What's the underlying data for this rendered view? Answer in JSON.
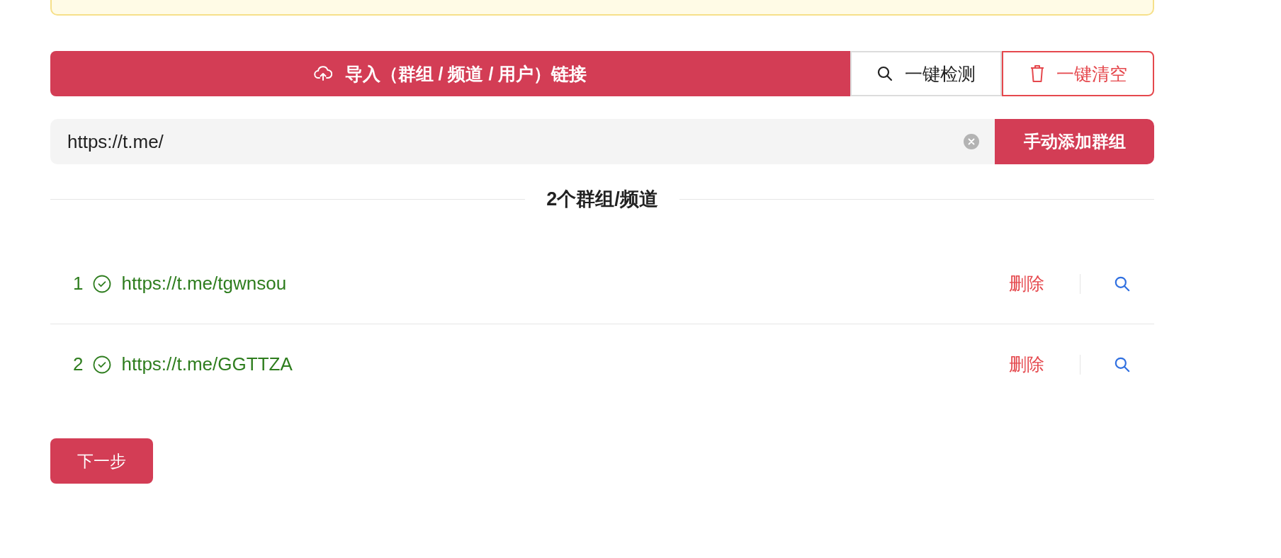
{
  "toolbar": {
    "import_button": "导入（群组 / 频道 / 用户）链接",
    "detect_button": "一键检测",
    "clear_button": "一键清空"
  },
  "link_input": {
    "value": "https://t.me/",
    "add_button": "手动添加群组"
  },
  "list_title": "2个群组/频道",
  "items": [
    {
      "index": "1",
      "url": "https://t.me/tgwnsou",
      "valid": true,
      "delete": "删除"
    },
    {
      "index": "2",
      "url": "https://t.me/GGTTZA",
      "valid": true,
      "delete": "删除"
    }
  ],
  "next_button": "下一步"
}
